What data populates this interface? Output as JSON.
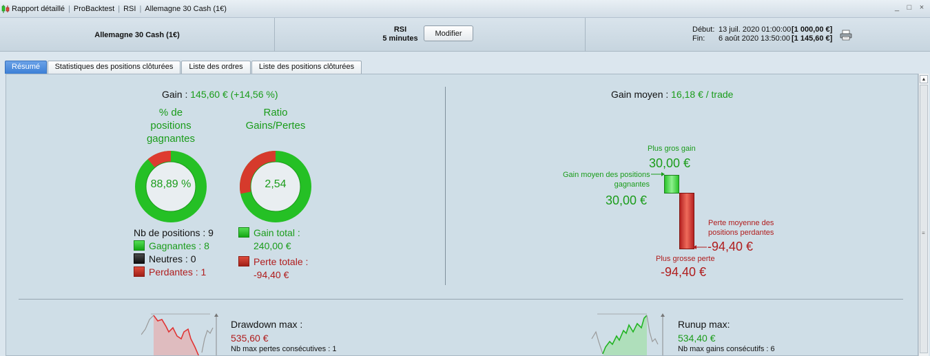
{
  "titlebar": {
    "crumbs": [
      "Rapport détaillé",
      "ProBacktest",
      "RSI",
      "Allemagne 30 Cash (1€)"
    ],
    "controls": [
      "_",
      "□",
      "×"
    ]
  },
  "header": {
    "instrument": "Allemagne 30 Cash (1€)",
    "strategy_name": "RSI",
    "timeframe": "5 minutes",
    "modify_label": "Modifier",
    "start_label": "Début:",
    "start_date": "13 juil. 2020 01:00:00",
    "start_amount": "[1 000,00 €]",
    "end_label": "Fin:",
    "end_date": "6 août 2020 13:50:00",
    "end_amount": "[1 145,60 €]",
    "print_icon": "printer-icon"
  },
  "tabs": [
    {
      "label": "Résumé",
      "active": true
    },
    {
      "label": "Statistiques des positions clôturées",
      "active": false
    },
    {
      "label": "Liste des ordres",
      "active": false
    },
    {
      "label": "Liste des positions clôturées",
      "active": false
    }
  ],
  "summary": {
    "gain_label": "Gain :",
    "gain_value": "145,60 € (+14,56 %)",
    "win_pct_title": [
      "% de",
      "positions",
      "gagnantes"
    ],
    "win_pct_value": "88,89 %",
    "win_fraction": 0.8889,
    "ratio_title": [
      "Ratio",
      "Gains/Pertes"
    ],
    "ratio_value": "2,54",
    "ratio_loss_fraction": 0.282,
    "nb_positions": "Nb de positions : 9",
    "winners": "Gagnantes : 8",
    "neutral": "Neutres : 0",
    "losers": "Perdantes : 1",
    "total_gain_label": "Gain total :",
    "total_gain_value": "240,00 €",
    "total_loss_label": "Perte totale :",
    "total_loss_value": "-94,40 €"
  },
  "averages": {
    "avg_gain_label": "Gain moyen :",
    "avg_gain_value": "16,18 € / trade",
    "best_gain_label": "Plus gros gain",
    "best_gain_value": "30,00 €",
    "avg_win_label": [
      "Gain moyen des positions",
      "gagnantes"
    ],
    "avg_win_value": "30,00 €",
    "avg_loss_label": [
      "Perte moyenne des",
      "positions perdantes"
    ],
    "avg_loss_value": "-94,40 €",
    "worst_loss_label": "Plus grosse perte",
    "worst_loss_value": "-94,40 €"
  },
  "bottom": {
    "drawdown_label": "Drawdown max :",
    "drawdown_value": "535,60 €",
    "max_consec_losses": "Nb max pertes consécutives : 1",
    "runup_label": "Runup max:",
    "runup_value": "534,40 €",
    "max_consec_gains": "Nb max gains consécutifs : 6"
  },
  "colors": {
    "green": "#1a9c1a",
    "red": "#b01c1c",
    "active_tab": "#3c7fd6"
  }
}
